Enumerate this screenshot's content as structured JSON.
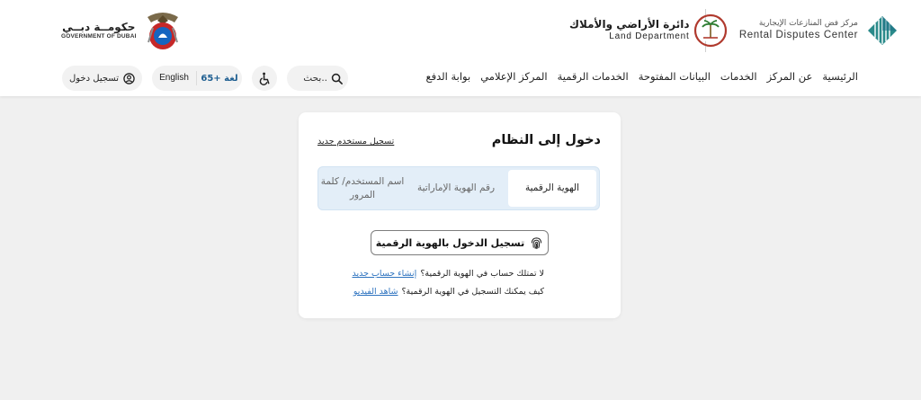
{
  "logos": {
    "rdc_ar": "مركز فض المنازعات الإيجارية",
    "rdc_en": "Rental Disputes Center",
    "land_ar": "دائرة الأراضي والأملاك",
    "land_en": "Land Department",
    "gov_ar": "حكومــة دبــي",
    "gov_en": "GOVERNMENT OF DUBAI"
  },
  "nav": {
    "items": [
      "الرئيسية",
      "عن المركز",
      "الخدمات",
      "البيانات المفتوحة",
      "الخدمات الرقمية",
      "المركز الإعلامي",
      "بوابة الدفع"
    ]
  },
  "toolbar": {
    "search_placeholder": "بحث..",
    "lang_en": "English",
    "lang_more": "65+ لغة",
    "login_label": "تسجيل دخول"
  },
  "login_card": {
    "title": "دخول إلى النظام",
    "register_link": "تسجيل مستخدم جديد",
    "tabs": [
      {
        "label": "الهوية الرقمية"
      },
      {
        "label": "رقم الهوية الإماراتية"
      },
      {
        "label": "اسم المستخدم/ كلمة المرور"
      }
    ],
    "uaepass_button": "تسجيل الدخول بالهوية الرقمية",
    "help1_text": "لا تمتلك حساب في الهوية الرقمية؟",
    "help1_link": "إنشاء حساب جديد",
    "help2_text": "كيف يمكنك التسجيل في الهوية الرقمية؟",
    "help2_link": "شاهد الفيديو"
  },
  "colors": {
    "accent_link": "#2f74c0",
    "tab_bg": "#e3eef8",
    "lang_more": "#1f5f91"
  },
  "icons": [
    "rdc-logo-icon",
    "land-department-logo-icon",
    "dubai-government-emblem-icon",
    "search-icon",
    "accessibility-icon",
    "user-circle-icon",
    "fingerprint-icon"
  ]
}
